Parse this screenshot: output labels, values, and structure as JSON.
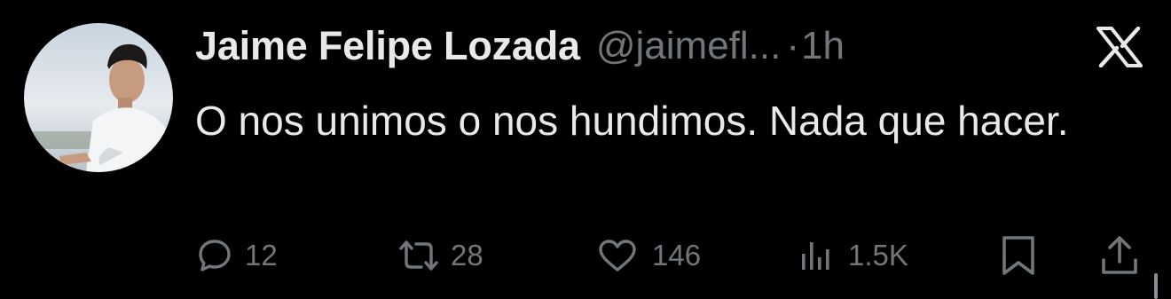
{
  "tweet": {
    "author": {
      "display_name": "Jaime Felipe Lozada",
      "handle": "@jaimefl...",
      "avatar_icon": "profile-photo"
    },
    "separator": "·",
    "timestamp": "1h",
    "text": "O nos unimos o nos hundimos. Nada que hacer.",
    "platform_icon": "x-logo-icon"
  },
  "actions": {
    "reply": {
      "icon": "reply-icon",
      "count": "12"
    },
    "retweet": {
      "icon": "retweet-icon",
      "count": "28"
    },
    "like": {
      "icon": "heart-icon",
      "count": "146"
    },
    "views": {
      "icon": "views-icon",
      "count": "1.5K"
    },
    "bookmark": {
      "icon": "bookmark-icon"
    },
    "share": {
      "icon": "share-icon"
    }
  },
  "colors": {
    "background": "#000000",
    "primary_text": "#e7e9ea",
    "secondary_text": "#71767b"
  }
}
